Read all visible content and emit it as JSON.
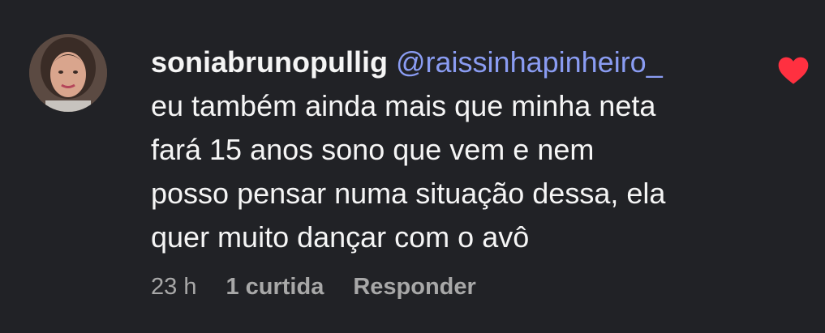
{
  "comment": {
    "username": "soniabrunopullig",
    "mention": "@raissinhapinheiro_",
    "lines": [
      "eu também ainda mais que minha neta",
      "fará 15 anos sono que vem e nem",
      "posso pensar numa situação dessa, ela",
      "quer muito dançar com o avô"
    ],
    "time": "23 h",
    "likes": "1 curtida",
    "reply_label": "Responder"
  },
  "colors": {
    "background": "#212226",
    "mention": "#8a9cf2",
    "heart": "#ff3040",
    "meta": "#a8a8a8"
  },
  "icons": {
    "like": "heart-icon"
  }
}
